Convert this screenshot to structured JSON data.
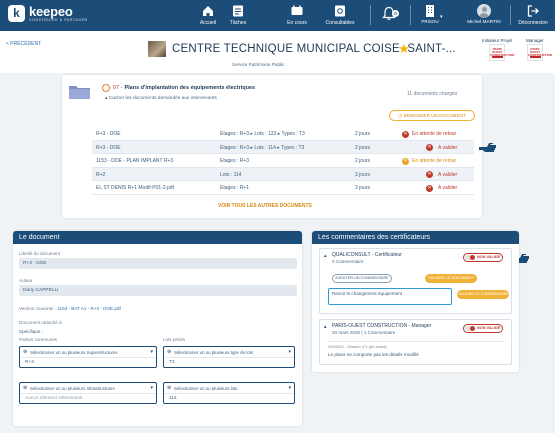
{
  "topbar": {
    "brand": "keepeo",
    "brand_sub": "CONSTRUIRE & PARTAGER",
    "nav": [
      {
        "label": "Accueil",
        "icon": "home-icon"
      },
      {
        "label": "Tâches",
        "icon": "tasks-icon"
      },
      {
        "label": "En cours",
        "icon": "in-progress-icon"
      },
      {
        "label": "Consultables",
        "icon": "consultables-icon"
      }
    ],
    "notif_count": "0",
    "org": "PRISOU",
    "user": "Michel MARTIN",
    "logout": "Déconnexion"
  },
  "header": {
    "back": "< PRÉCÉDENT",
    "title": "CENTRE TECHNIQUE MUNICIPAL COISE -SAINT-...",
    "service": "Service Patrimoine Public",
    "initiator_label": "Initiateur Projet",
    "manager_label": "Manager",
    "logo_text": "PARIS OUEST CONSTRUCTION"
  },
  "step": {
    "number": "07 -",
    "title": "Plans d'implantation des équipements électriques",
    "hide_docs": "Cacher les documents demandés aux intervenants",
    "docs_count": "11 documents chargés",
    "request_btn": "DEMANDER UN DOCUMENT",
    "see_all": "VOIR TOUS LES AUTRES DOCUMENTS",
    "rows": [
      {
        "name": "R+3 - DOE",
        "meta": "Etages : R+3 ▸ Lots : 123 ▸ Types : T3",
        "duration": "2 jours",
        "status": "En attente de retour",
        "color": "red"
      },
      {
        "name": "R+3 - DOE",
        "meta": "Etages : R+3 ▸ Lots : 114 ▸ Types : T3",
        "duration": "2 jours",
        "status": "A valider",
        "color": "red"
      },
      {
        "name": "1153 - DOE - PLAN IMPLANT R+3",
        "meta": "Etages : R+3",
        "duration": "2 jours",
        "status": "En attente de retour",
        "color": "orange"
      },
      {
        "name": "R+2",
        "meta": "Lots : 114",
        "duration": "3 jours",
        "status": "A valider",
        "color": "red"
      },
      {
        "name": "EL ST DENIS R+1 Modif-P01-2.pdf",
        "meta": "Etages : R+1",
        "duration": "3 jours",
        "status": "A valider",
        "color": "red"
      }
    ]
  },
  "document": {
    "heading": "Le document",
    "label_lbl": "Libellé du document",
    "label_val": "R+3 - DOE",
    "author_lbl": "Auteur",
    "author_val": "Dany CAPPELLI",
    "version_lbl": "Version courante :",
    "version_val": "1153 - BAT A1 - R+3 - DOE.pdf",
    "attached_lbl": "Document rattaché à",
    "specific_lbl": "Spécifique :",
    "common_lbl": "Parties communes",
    "private_lbl": "Lots privés",
    "sel_super": "Sélectionner un ou plusieurs Superstructures",
    "sel_super_val": "R+3",
    "sel_types": "Sélectionner un ou plusieurs type de lots",
    "sel_types_val": "T3",
    "sel_infra": "Sélectionner un ou plusieurs Infrastructures",
    "sel_infra_val": "Aucun élément sélectionné",
    "sel_lots": "Sélectionner un ou plusieurs lots",
    "sel_lots_val": "114"
  },
  "comments": {
    "heading": "Les commentaires des certificateurs",
    "c1_name": "QUALICONSULT - Certificateur",
    "c1_sub": "0 Commentaire",
    "c1_badge": "NON VALIDÉ",
    "add_btn": "AJOUTER UN COMMENTAIRE",
    "validate_doc": "VALIDER LE DOCUMENT",
    "input_text": "Revoir le changement équipement",
    "validate_comments": "VALIDER LE COMMENTAIRE",
    "c2_name": "PARIS-OUEST CONSTRUCTION - Manager",
    "c2_sub": "20 mars 2020 | 1 Commentaire",
    "c2_badge": "NON VALIDÉ",
    "c2_meta": "20/03/20 - Version n°1 (en cours)",
    "c2_text": "Le plans ne comporte pas les détails modifié"
  },
  "colors": {
    "navy": "#1c4c78",
    "red": "#c0392b",
    "orange": "#f0a020",
    "star": "#f4b400"
  }
}
